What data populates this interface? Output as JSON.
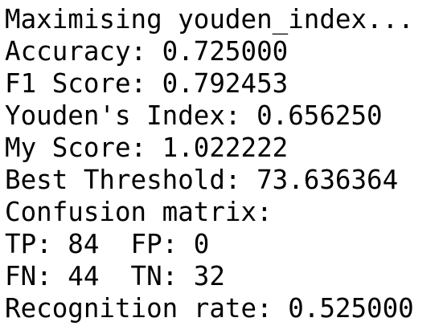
{
  "output": {
    "lines": [
      "Maximising youden_index...",
      "Accuracy: 0.725000",
      "F1 Score: 0.792453",
      "Youden's Index: 0.656250",
      "My Score: 1.022222",
      "Best Threshold: 73.636364",
      "Confusion matrix:",
      "TP: 84  FP: 0",
      "FN: 44  TN: 32",
      "Recognition rate: 0.525000"
    ]
  }
}
